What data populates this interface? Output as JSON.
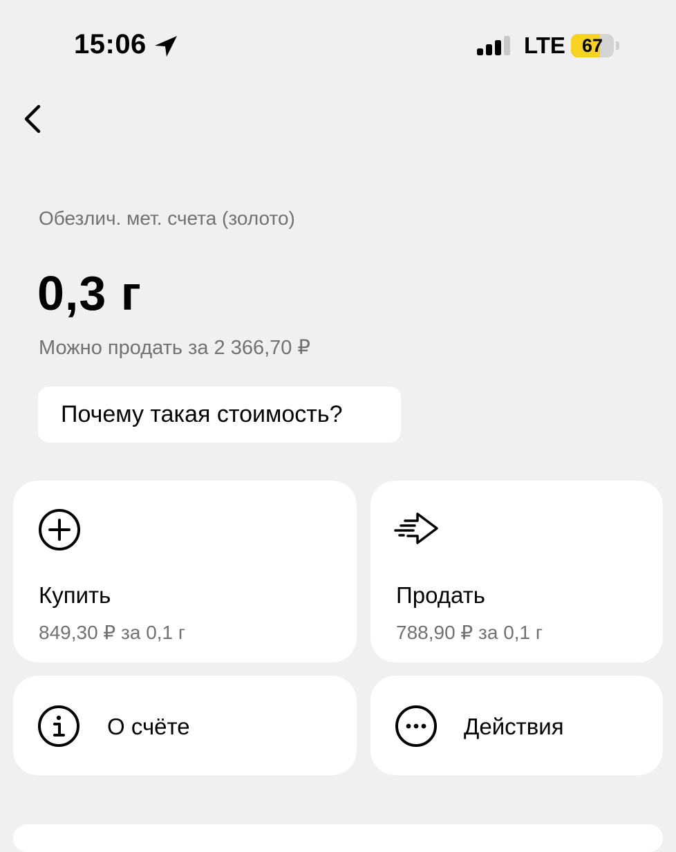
{
  "status_bar": {
    "time": "15:06",
    "network": "LTE",
    "battery": "67",
    "battery_level": 0.67,
    "battery_color": "#f7d21e",
    "location_icon": "location-arrow-icon",
    "signal_icon": "cellular-signal-icon"
  },
  "nav": {
    "back_icon": "chevron-left-icon"
  },
  "account": {
    "type": "Обезлич. мет. счета (золото)",
    "amount": "0,3 г",
    "sell_estimate": "Можно продать за 2 366,70 ₽"
  },
  "why_button": {
    "label": "Почему такая стоимость?"
  },
  "actions": {
    "buy": {
      "icon": "plus-circle-icon",
      "title": "Купить",
      "price": "849,30 ₽ за 0,1 г"
    },
    "sell": {
      "icon": "fast-arrow-right-icon",
      "title": "Продать",
      "price": "788,90 ₽ за 0,1 г"
    },
    "info": {
      "icon": "info-circle-icon",
      "label": "О счёте"
    },
    "more": {
      "icon": "more-horizontal-circle-icon",
      "label": "Действия"
    }
  }
}
